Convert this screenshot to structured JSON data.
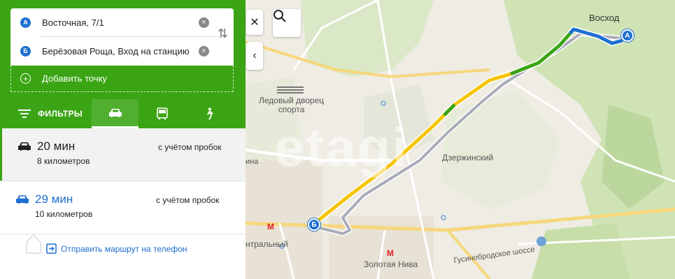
{
  "route": {
    "from": {
      "badge": "А",
      "address": "Восточная, 7/1"
    },
    "to": {
      "badge": "Б",
      "address": "Берёзовая Роща, Вход на станцию"
    },
    "add_point_label": "Добавить точку"
  },
  "tabs": {
    "filters_label": "ФИЛЬТРЫ",
    "modes": [
      "car",
      "bus",
      "walk"
    ],
    "active_mode": "car"
  },
  "options": [
    {
      "time": "20 мин",
      "distance": "8 километров",
      "traffic": "с учётом пробок",
      "selected": true
    },
    {
      "time": "29 мин",
      "distance": "10 километров",
      "traffic": "с учётом пробок",
      "selected": false
    }
  ],
  "send_label": "Отправить маршрут на телефон",
  "map": {
    "watermark": "etagi",
    "labels": {
      "voskhod": "Восход",
      "ice_palace": "Ледовый дворец\nспорта",
      "dzerzhinsky": "Дзержинский",
      "central": "нтральный",
      "zolotaya_niva": "Золотая Нива",
      "gusinobrodskoe": "Гусинобродское шоссе",
      "street_ina": "ина"
    },
    "pin_a": "А",
    "pin_b": "Б"
  },
  "colors": {
    "brand_green": "#3aa414",
    "route_blue": "#1e6fd0",
    "traffic_yellow": "#f5c400",
    "traffic_green": "#3aa414",
    "alt_route": "#a9acb8"
  }
}
